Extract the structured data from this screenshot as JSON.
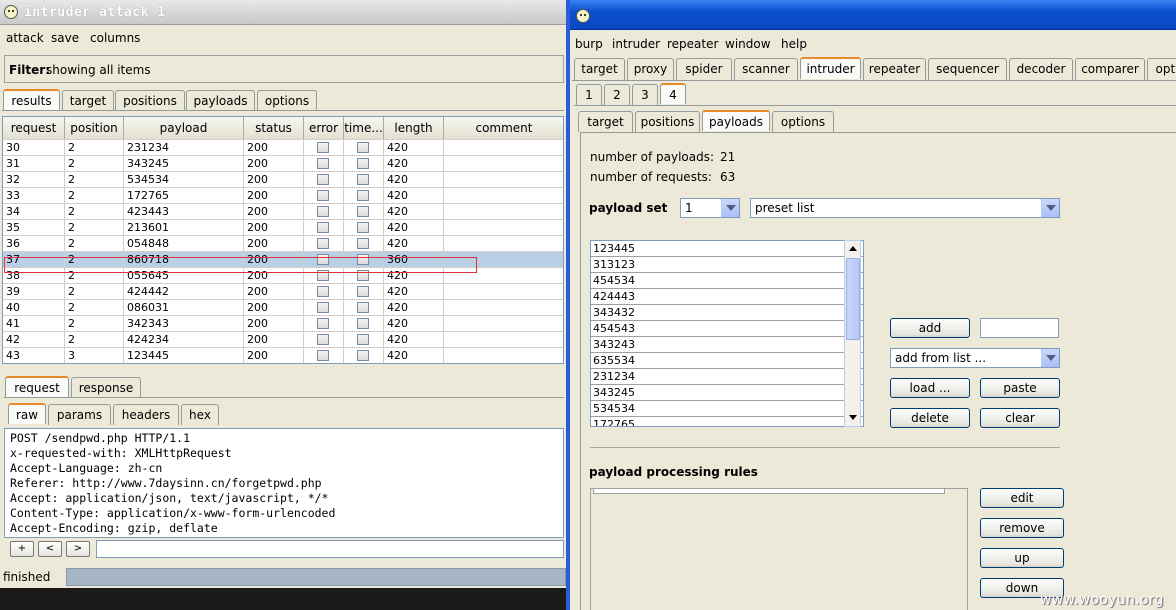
{
  "left_window": {
    "title": "intruder attack 1",
    "menu": [
      "attack",
      "save",
      "columns"
    ],
    "filter_label": "Filter:",
    "filter_value": "showing all items",
    "tabs": [
      "results",
      "target",
      "positions",
      "payloads",
      "options"
    ],
    "table": {
      "columns": [
        "request",
        "position",
        "payload",
        "status",
        "error",
        "time...",
        "length",
        "comment"
      ],
      "rows": [
        {
          "request": "30",
          "position": "2",
          "payload": "231234",
          "status": "200",
          "length": "420"
        },
        {
          "request": "31",
          "position": "2",
          "payload": "343245",
          "status": "200",
          "length": "420"
        },
        {
          "request": "32",
          "position": "2",
          "payload": "534534",
          "status": "200",
          "length": "420"
        },
        {
          "request": "33",
          "position": "2",
          "payload": "172765",
          "status": "200",
          "length": "420"
        },
        {
          "request": "34",
          "position": "2",
          "payload": "423443",
          "status": "200",
          "length": "420"
        },
        {
          "request": "35",
          "position": "2",
          "payload": "213601",
          "status": "200",
          "length": "420"
        },
        {
          "request": "36",
          "position": "2",
          "payload": "054848",
          "status": "200",
          "length": "420"
        },
        {
          "request": "37",
          "position": "2",
          "payload": "860718",
          "status": "200",
          "length": "360"
        },
        {
          "request": "38",
          "position": "2",
          "payload": "055645",
          "status": "200",
          "length": "420"
        },
        {
          "request": "39",
          "position": "2",
          "payload": "424442",
          "status": "200",
          "length": "420"
        },
        {
          "request": "40",
          "position": "2",
          "payload": "086031",
          "status": "200",
          "length": "420"
        },
        {
          "request": "41",
          "position": "2",
          "payload": "342343",
          "status": "200",
          "length": "420"
        },
        {
          "request": "42",
          "position": "2",
          "payload": "424234",
          "status": "200",
          "length": "420"
        },
        {
          "request": "43",
          "position": "3",
          "payload": "123445",
          "status": "200",
          "length": "420"
        }
      ]
    },
    "detail_tabs": [
      "request",
      "response"
    ],
    "view_tabs": [
      "raw",
      "params",
      "headers",
      "hex"
    ],
    "request_lines": [
      "POST /sendpwd.php HTTP/1.1",
      "x-requested-with: XMLHttpRequest",
      "Accept-Language: zh-cn",
      "Referer: http://www.7daysinn.cn/forgetpwd.php",
      "Accept: application/json, text/javascript, */*",
      "Content-Type: application/x-www-form-urlencoded",
      "Accept-Encoding: gzip, deflate"
    ],
    "nav_buttons": [
      "+",
      "<",
      ">"
    ],
    "status": "finished"
  },
  "right_window": {
    "menu": [
      "burp",
      "intruder",
      "repeater",
      "window",
      "help"
    ],
    "main_tabs": [
      "target",
      "proxy",
      "spider",
      "scanner",
      "intruder",
      "repeater",
      "sequencer",
      "decoder",
      "comparer",
      "opti"
    ],
    "attack_tabs": [
      "1",
      "2",
      "3",
      "4"
    ],
    "sub_tabs": [
      "target",
      "positions",
      "payloads",
      "options"
    ],
    "num_payloads_label": "number of payloads:",
    "num_payloads": "21",
    "num_requests_label": "number of requests:",
    "num_requests": "63",
    "payload_set_label": "payload set",
    "payload_set_value": "1",
    "payload_type": "preset list",
    "payload_list": [
      "123445",
      "313123",
      "454534",
      "424443",
      "343432",
      "454543",
      "343243",
      "635534",
      "231234",
      "343245",
      "534534",
      "172765"
    ],
    "buttons": {
      "add": "add",
      "load": "load ...",
      "paste": "paste",
      "delete": "delete",
      "clear": "clear"
    },
    "add_from_list": "add from list ...",
    "processing_label": "payload processing rules",
    "rule_buttons": {
      "edit": "edit",
      "remove": "remove",
      "up": "up",
      "down": "down"
    }
  },
  "watermark": "www.wooyun.org"
}
